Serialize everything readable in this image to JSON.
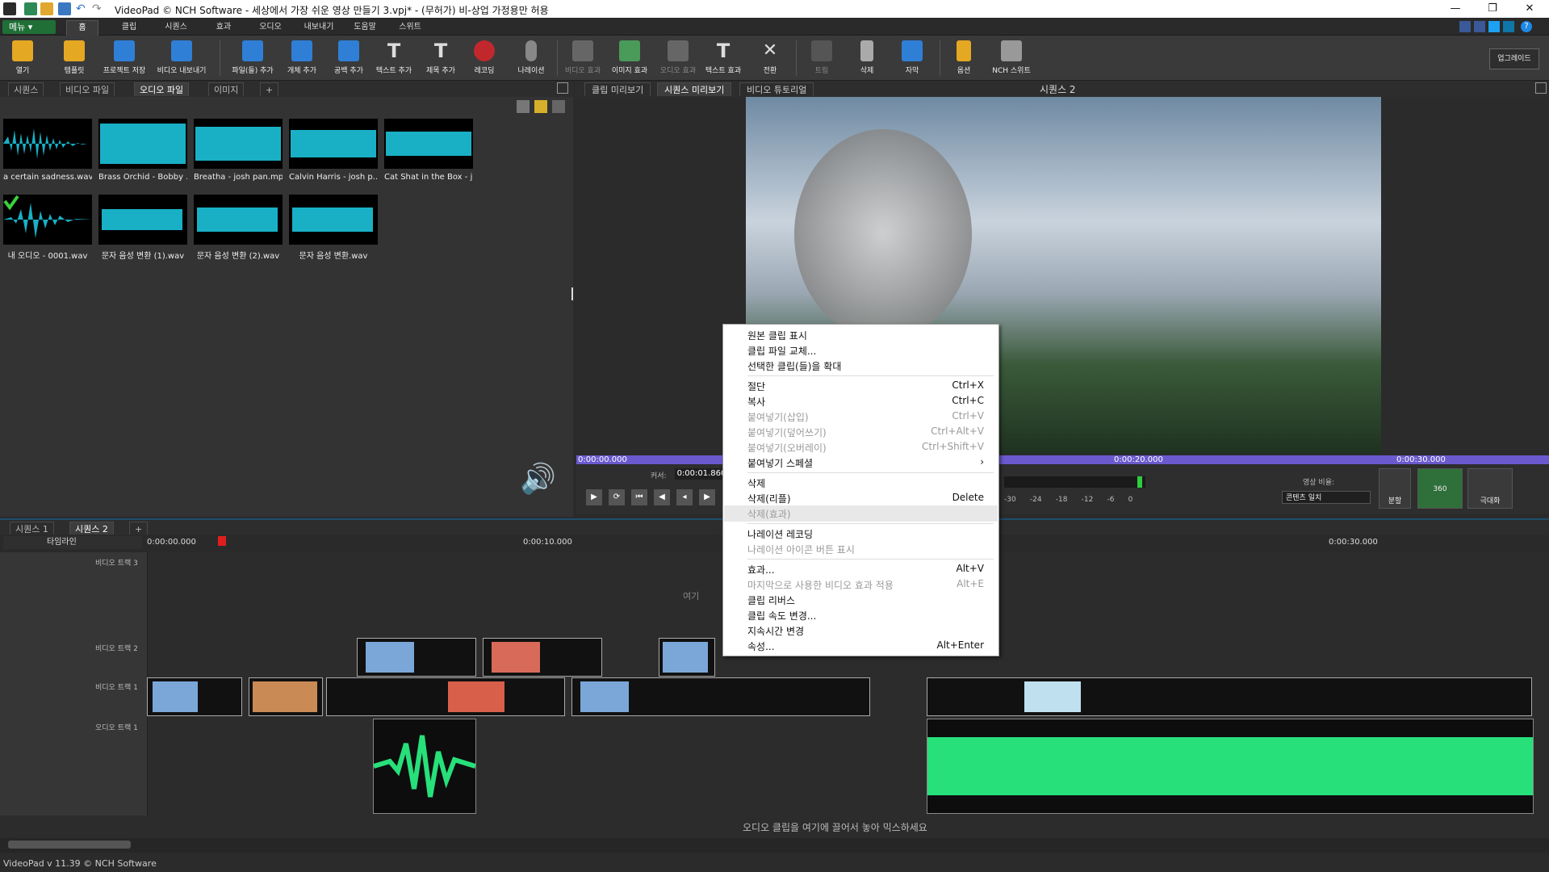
{
  "window": {
    "title": "VideoPad © NCH Software - 세상에서 가장 쉬운 영상 만들기 3.vpj* - (무허가) 비-상업 가정용만 허용"
  },
  "menu": {
    "menu_button": "메뉴 ▾",
    "tabs": [
      "홈",
      "클립",
      "시퀀스",
      "효과",
      "오디오",
      "내보내기",
      "도움말",
      "스위트"
    ]
  },
  "toolbar": {
    "buttons": [
      "열기",
      "템플릿",
      "프로젝트 저장",
      "비디오 내보내기",
      "파일(들) 추가",
      "개체 추가",
      "공백 추가",
      "텍스트 추가",
      "제목 추가",
      "레코딩",
      "나레이션",
      "비디오 효과",
      "이미지 효과",
      "오디오 효과",
      "텍스트 효과",
      "전환",
      "트림",
      "삭제",
      "자막",
      "옵션",
      "NCH 스위트"
    ],
    "upgrade": "업그레이드"
  },
  "bin": {
    "tabs": [
      "시퀀스",
      "비디오 파일",
      "오디오 파일",
      "이미지",
      "+"
    ],
    "clips": [
      "a certain sadness.wav",
      "Brass Orchid - Bobby ...",
      "Breatha - josh pan.mp3",
      "Calvin Harris - josh p...",
      "Cat Shat in the Box - j...",
      "내 오디오 - 0001.wav",
      "문자 음성 변환 (1).wav",
      "문자 음성 변환 (2).wav",
      "문자 음성 변환.wav"
    ]
  },
  "preview": {
    "tabs": [
      "클립 미리보기",
      "시퀀스 미리보기",
      "비디오 튜토리얼"
    ],
    "title": "시퀀스 2",
    "timecodes": [
      "0:00:00.000",
      "0:00:20.000",
      "0:00:30.000"
    ],
    "cursor_label": "커서:",
    "cursor_value": "0:00:01.860",
    "meter": [
      "-30",
      "-24",
      "-18",
      "-12",
      "-6",
      "0"
    ],
    "aspect_label": "영상 비율:",
    "aspect_value": "콘텐츠 일치",
    "split": "분할",
    "btn360": "360",
    "fullscreen": "극대화"
  },
  "sequence": {
    "tabs": [
      "시퀀스 1",
      "시퀀스 2",
      "+"
    ],
    "timeline_label": "타임라인",
    "ruler": [
      "0:00:00.000",
      "0:00:10.000",
      "0:00:30.000"
    ],
    "tracks": [
      "비디오 트랙 3",
      "비디오 트랙 2",
      "비디오 트랙 1",
      "오디오 트랙 1"
    ],
    "drop_video": "여기",
    "drop_audio": "오디오 클립을 여기에 끌어서 놓아 믹스하세요"
  },
  "status": {
    "version": "VideoPad v 11.39 © NCH Software"
  },
  "context_menu": {
    "items": [
      {
        "label": "원본 클립 표시",
        "shortcut": "",
        "enabled": true
      },
      {
        "label": "클립 파일 교체...",
        "shortcut": "",
        "enabled": true
      },
      {
        "label": "선택한 클립(들)을 확대",
        "shortcut": "",
        "enabled": true
      },
      {
        "label": "절단",
        "shortcut": "Ctrl+X",
        "enabled": true
      },
      {
        "label": "복사",
        "shortcut": "Ctrl+C",
        "enabled": true
      },
      {
        "label": "붙여넣기(삽입)",
        "shortcut": "Ctrl+V",
        "enabled": false
      },
      {
        "label": "붙여넣기(덮어쓰기)",
        "shortcut": "Ctrl+Alt+V",
        "enabled": false
      },
      {
        "label": "붙여넣기(오버레이)",
        "shortcut": "Ctrl+Shift+V",
        "enabled": false
      },
      {
        "label": "붙여넣기 스페셜",
        "shortcut": "›",
        "enabled": true
      },
      {
        "label": "삭제",
        "shortcut": "",
        "enabled": true
      },
      {
        "label": "삭제(리플)",
        "shortcut": "Delete",
        "enabled": true
      },
      {
        "label": "삭제(효과)",
        "shortcut": "",
        "enabled": false
      },
      {
        "label": "나레이션 레코딩",
        "shortcut": "",
        "enabled": true
      },
      {
        "label": "나레이션 아이콘 버튼 표시",
        "shortcut": "",
        "enabled": false
      },
      {
        "label": "효과...",
        "shortcut": "Alt+V",
        "enabled": true
      },
      {
        "label": "마지막으로 사용한 비디오 효과 적용",
        "shortcut": "Alt+E",
        "enabled": false
      },
      {
        "label": "클립 리버스",
        "shortcut": "",
        "enabled": true
      },
      {
        "label": "클립 속도 변경...",
        "shortcut": "",
        "enabled": true
      },
      {
        "label": "지속시간 변경",
        "shortcut": "",
        "enabled": true
      },
      {
        "label": "속성...",
        "shortcut": "Alt+Enter",
        "enabled": true
      }
    ]
  }
}
